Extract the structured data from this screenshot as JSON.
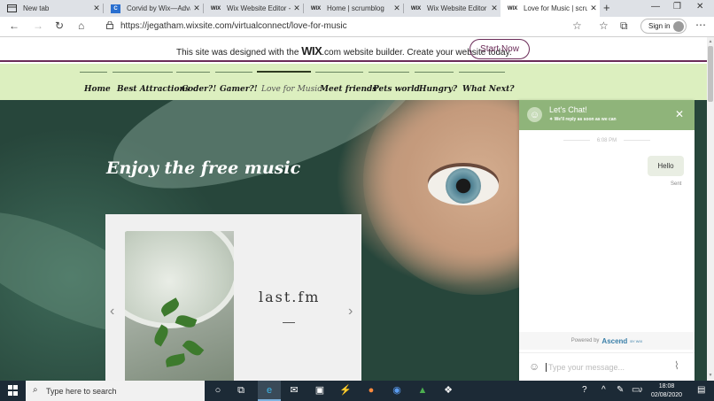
{
  "browser": {
    "tabs": [
      {
        "title": "New tab",
        "icon": "page-icon",
        "active": false
      },
      {
        "title": "Corvid by Wix—Advan",
        "icon": "corvid-icon",
        "active": false
      },
      {
        "title": "Wix Website Editor - vi",
        "icon": "wix-icon",
        "active": false
      },
      {
        "title": "Home | scrumblog",
        "icon": "wix-icon",
        "active": false
      },
      {
        "title": "Wix Website Editor - vi",
        "icon": "wix-icon",
        "active": false
      },
      {
        "title": "Love for Music | scrum",
        "icon": "wix-icon",
        "active": true
      }
    ],
    "url": "https://jegatham.wixsite.com/virtualconnect/love-for-music",
    "sign_in_label": "Sign in"
  },
  "wix_banner": {
    "text_before": "This site was designed with the ",
    "brand": "WIX",
    "text_after": ".com website builder. Create your website today.",
    "button": "Start Now"
  },
  "site_nav": {
    "items": [
      "Home",
      "Best Attractions",
      "Coder?!",
      "Gamer?!",
      "Love for Music",
      "Meet friends",
      "Pets world",
      "Hungry?",
      "What Next?"
    ],
    "active_index": 4
  },
  "hero": {
    "title": "Enjoy the free music",
    "card_title": "last.fm"
  },
  "chat": {
    "title": "Let's Chat!",
    "subtitle": "We'll reply as soon as we can",
    "time": "6:08 PM",
    "message": "Hello",
    "status": "Sent",
    "powered_by": "Powered by",
    "powered_brand": "Ascend",
    "powered_suffix": "BY WIX",
    "input_placeholder": "Type your message..."
  },
  "taskbar": {
    "search_placeholder": "Type here to search",
    "time": "18:08",
    "date": "02/08/2020"
  },
  "colors": {
    "wix_purple": "#6b2b58",
    "nav_bg": "#dcefbf",
    "chat_header": "#8fb47a"
  }
}
